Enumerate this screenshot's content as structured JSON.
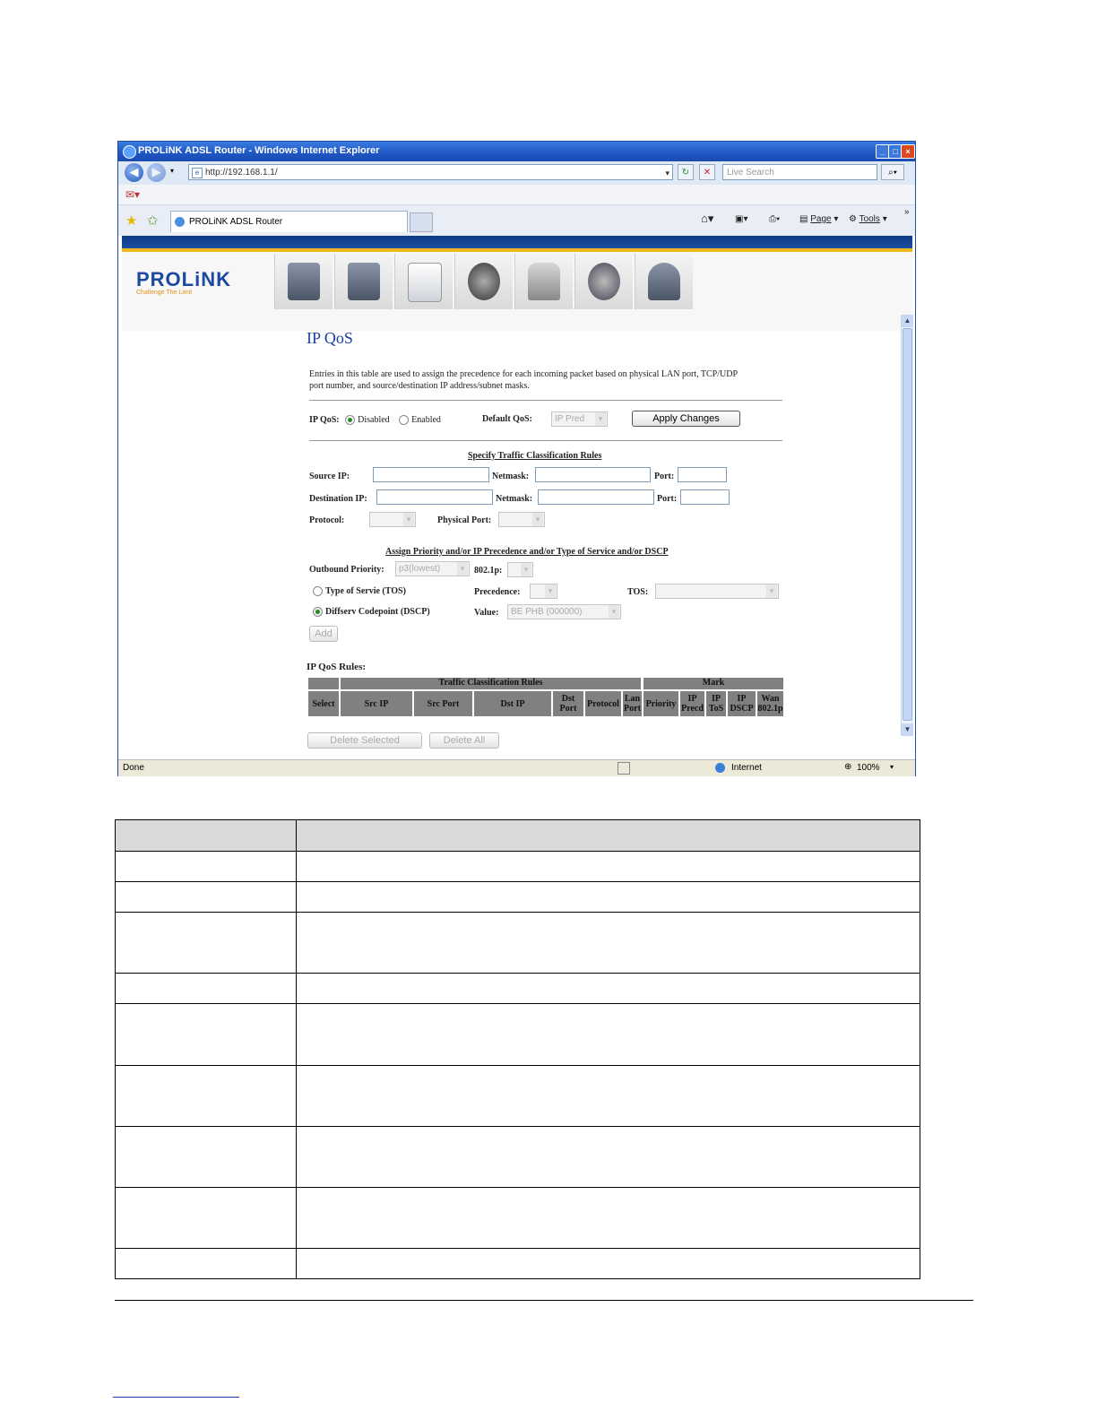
{
  "browser": {
    "window_title": "PROLiNK ADSL Router - Windows Internet Explorer",
    "address": "http://192.168.1.1/",
    "search_placeholder": "Live Search",
    "tab_title": "PROLiNK ADSL Router",
    "page_menu": "Page",
    "tools_menu": "Tools",
    "status_text": "Done",
    "zone": "Internet",
    "zoom": "100%"
  },
  "router": {
    "logo": "PROLiNK",
    "tagline": "Challenge The Limit",
    "nav_icons": [
      "status-icon",
      "setup-icon",
      "advanced-icon",
      "service-icon",
      "security-icon",
      "maintenance-icon",
      "admin-icon"
    ]
  },
  "page": {
    "title": "IP QoS",
    "intro_line1": "Entries in this table are used to assign the precedence for each incoming packet based on physical LAN port, TCP/UDP",
    "intro_line2": "port number, and source/destination IP address/subnet masks.",
    "ipqos_label": "IP QoS:",
    "disabled_label": "Disabled",
    "enabled_label": "Enabled",
    "ipqos_state": "Disabled",
    "default_qos_label": "Default QoS:",
    "default_qos_value": "IP Pred",
    "apply_button": "Apply Changes",
    "classification_heading": "Specify Traffic Classification Rules",
    "source_ip_label": "Source IP:",
    "netmask_label": "Netmask:",
    "port_label": "Port:",
    "dest_ip_label": "Destination IP:",
    "protocol_label": "Protocol:",
    "physical_port_label": "Physical Port:",
    "assign_heading": "Assign Priority and/or IP Precedence and/or Type of Service and/or DSCP",
    "outbound_priority_label": "Outbound Priority:",
    "outbound_priority_value": "p3(lowest)",
    "dot1p_label": "802.1p:",
    "tos_radio_label": "Type of Servie (TOS)",
    "precedence_label": "Precedence:",
    "tos_label": "TOS:",
    "dscp_radio_label": "Diffserv Codepoint (DSCP)",
    "value_label": "Value:",
    "value_value": "BE PHB (000000)",
    "add_button": "Add",
    "rules_label": "IP QoS Rules:",
    "group_traffic": "Traffic Classification Rules",
    "group_mark": "Mark",
    "columns": [
      "Select",
      "Src IP",
      "Src Port",
      "Dst IP",
      "Dst Port",
      "Protocol",
      "Lan Port",
      "Priority",
      "IP Precd",
      "IP ToS",
      "IP DSCP",
      "Wan 802.1p"
    ],
    "delete_selected": "Delete Selected",
    "delete_all": "Delete All"
  }
}
